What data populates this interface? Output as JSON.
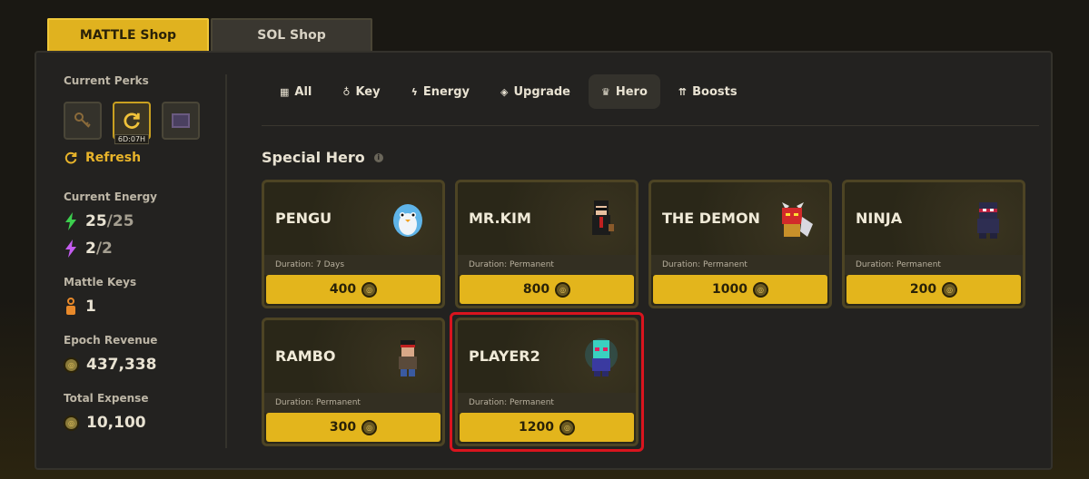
{
  "shop_tabs": [
    {
      "label": "MATTLE Shop",
      "active": true
    },
    {
      "label": "SOL Shop",
      "active": false
    }
  ],
  "sidebar": {
    "perks_label": "Current Perks",
    "perk_timer": "6D:07H",
    "refresh_label": "Refresh",
    "energy_label": "Current Energy",
    "energy_green_current": "25",
    "energy_green_max": "/25",
    "energy_purple_current": "2",
    "energy_purple_max": "/2",
    "keys_label": "Mattle Keys",
    "keys_value": "1",
    "revenue_label": "Epoch Revenue",
    "revenue_value": "437,338",
    "expense_label": "Total Expense",
    "expense_value": "10,100"
  },
  "categories": [
    {
      "label": "All",
      "icon": "grid-icon",
      "active": false
    },
    {
      "label": "Key",
      "icon": "key-icon",
      "active": false
    },
    {
      "label": "Energy",
      "icon": "bolt-icon",
      "active": false
    },
    {
      "label": "Upgrade",
      "icon": "diamond-icon",
      "active": false
    },
    {
      "label": "Hero",
      "icon": "crown-icon",
      "active": true
    },
    {
      "label": "Boosts",
      "icon": "arrows-up-icon",
      "active": false
    }
  ],
  "section_title": "Special Hero",
  "heroes": [
    {
      "name": "PENGU",
      "duration": "Duration: 7 Days",
      "price": "400",
      "highlighted": false
    },
    {
      "name": "MR.KIM",
      "duration": "Duration: Permanent",
      "price": "800",
      "highlighted": false
    },
    {
      "name": "THE DEMON",
      "duration": "Duration: Permanent",
      "price": "1000",
      "highlighted": false
    },
    {
      "name": "NINJA",
      "duration": "Duration: Permanent",
      "price": "200",
      "highlighted": false
    },
    {
      "name": "RAMBO",
      "duration": "Duration: Permanent",
      "price": "300",
      "highlighted": false
    },
    {
      "name": "PLAYER2",
      "duration": "Duration: Permanent",
      "price": "1200",
      "highlighted": true
    }
  ],
  "colors": {
    "accent": "#e3b51c",
    "highlight": "#d9141e",
    "energy_green": "#3ccf4e",
    "energy_purple": "#c45cf0"
  }
}
